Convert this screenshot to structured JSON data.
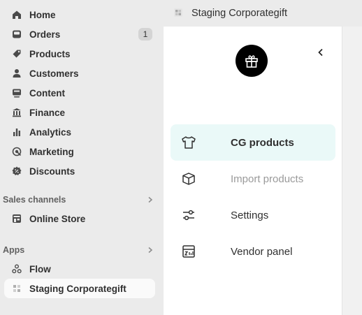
{
  "nav": {
    "items": [
      {
        "label": "Home",
        "icon": "home-icon"
      },
      {
        "label": "Orders",
        "icon": "inbox-icon",
        "badge": "1"
      },
      {
        "label": "Products",
        "icon": "tag-icon"
      },
      {
        "label": "Customers",
        "icon": "person-icon"
      },
      {
        "label": "Content",
        "icon": "content-icon"
      },
      {
        "label": "Finance",
        "icon": "bank-icon"
      },
      {
        "label": "Analytics",
        "icon": "bar-chart-icon"
      },
      {
        "label": "Marketing",
        "icon": "target-icon"
      },
      {
        "label": "Discounts",
        "icon": "discount-icon"
      }
    ],
    "sales_channels": {
      "title": "Sales channels",
      "items": [
        {
          "label": "Online Store",
          "icon": "store-icon"
        }
      ]
    },
    "apps": {
      "title": "Apps",
      "items": [
        {
          "label": "Flow",
          "icon": "flow-icon"
        },
        {
          "label": "Staging Corporategift",
          "icon": "app-icon"
        }
      ]
    }
  },
  "app": {
    "title": "Staging Corporategift",
    "menu": [
      {
        "label": "CG products",
        "icon": "shirt-icon",
        "state": "active"
      },
      {
        "label": "Import products",
        "icon": "box-icon",
        "state": "disabled"
      },
      {
        "label": "Settings",
        "icon": "sliders-icon",
        "state": "normal"
      },
      {
        "label": "Vendor panel",
        "icon": "vendor-panel-icon",
        "state": "normal"
      }
    ]
  },
  "colors": {
    "nav_bg": "#ebebeb",
    "active_menu_bg": "#eaf9f8",
    "logo_bg": "#000000"
  }
}
